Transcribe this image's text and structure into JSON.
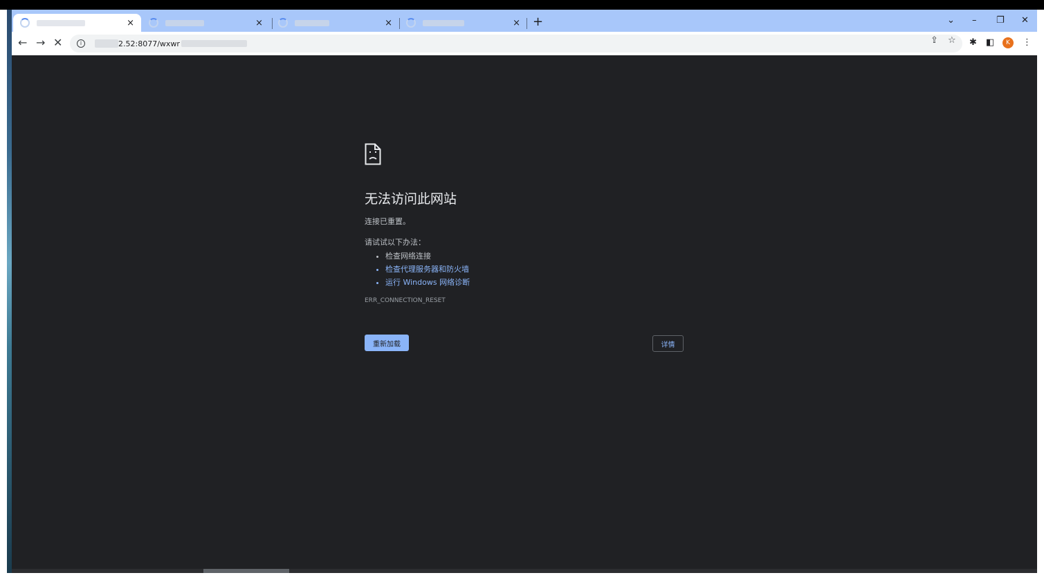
{
  "tabs": [
    {
      "close": "×"
    },
    {
      "close": "×"
    },
    {
      "close": "×"
    },
    {
      "close": "×"
    }
  ],
  "new_tab_label": "+",
  "window_controls": {
    "tab_search": "⌄",
    "minimize": "–",
    "restore": "❐",
    "close": "✕"
  },
  "nav": {
    "back": "←",
    "forward": "→",
    "stop": "✕"
  },
  "address": {
    "info_icon": "i",
    "url_visible": "2.52:8077/wxwr"
  },
  "toolbar_icons": {
    "share": "⇪",
    "bookmark": "☆",
    "extensions": "✱",
    "side_panel": "◧",
    "menu": "⋮"
  },
  "profile": {
    "initial": "K"
  },
  "error": {
    "title": "无法访问此网站",
    "subtitle": "连接已重置。",
    "try_label": "请试试以下办法：",
    "suggestions": [
      "检查网络连接",
      "检查代理服务器和防火墙",
      "运行 Windows 网络诊断"
    ],
    "code": "ERR_CONNECTION_RESET",
    "reload_button": "重新加载",
    "details_button": "详情"
  },
  "colors": {
    "background": "#202124",
    "link": "#8ab4f8",
    "tab_strip": "#a8c7fa"
  }
}
